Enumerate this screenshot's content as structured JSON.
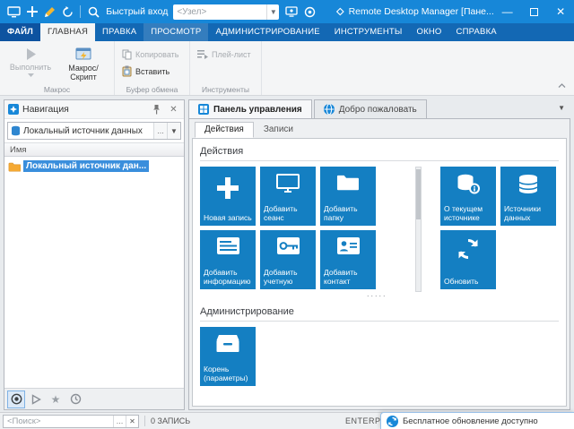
{
  "window": {
    "title": "Remote Desktop Manager [Пане...",
    "quick_connect_label": "Быстрый вход",
    "node_placeholder": "<Узел>"
  },
  "menu": {
    "tabs": [
      "ФАЙЛ",
      "ГЛАВНАЯ",
      "ПРАВКА",
      "ПРОСМОТР",
      "АДМИНИСТРИРОВАНИЕ",
      "ИНСТРУМЕНТЫ",
      "ОКНО",
      "СПРАВКА"
    ]
  },
  "ribbon": {
    "run": "Выполнить",
    "macro": "Макрос/Скрипт",
    "copy": "Копировать",
    "paste": "Вставить",
    "playlist": "Плей-лист",
    "groups": {
      "macro": "Макрос",
      "clipboard": "Буфер обмена",
      "tools": "Инструменты"
    }
  },
  "navigation": {
    "title": "Навигация",
    "datasource": "Локальный источник данных",
    "column": "Имя",
    "item": "Локальный источник дан...",
    "search_placeholder": "<Поиск>"
  },
  "main": {
    "doc_tabs": [
      "Панель управления",
      "Добро пожаловать"
    ],
    "subtabs": [
      "Действия",
      "Записи"
    ],
    "sections": {
      "actions": "Действия",
      "admin": "Администрирование"
    },
    "tiles": {
      "new_entry": "Новая запись",
      "add_session": "Добавить сеанс",
      "add_folder": "Добавить папку",
      "add_info": "Добавить информацию",
      "add_account": "Добавить учетную",
      "add_contact": "Добавить контакт",
      "about_source": "О текущем источнике",
      "data_sources": "Источники данных",
      "refresh": "Обновить",
      "root": "Корень (параметры)"
    },
    "overflow_dots": "....."
  },
  "status": {
    "count": "0 ЗАПИСЬ",
    "edition": "ENTERPRISE"
  },
  "notification": {
    "text": "Бесплатное обновление доступно"
  },
  "colors": {
    "titlebar": "#1787d8",
    "tile": "#147fc2",
    "selection": "#3a8edc"
  }
}
